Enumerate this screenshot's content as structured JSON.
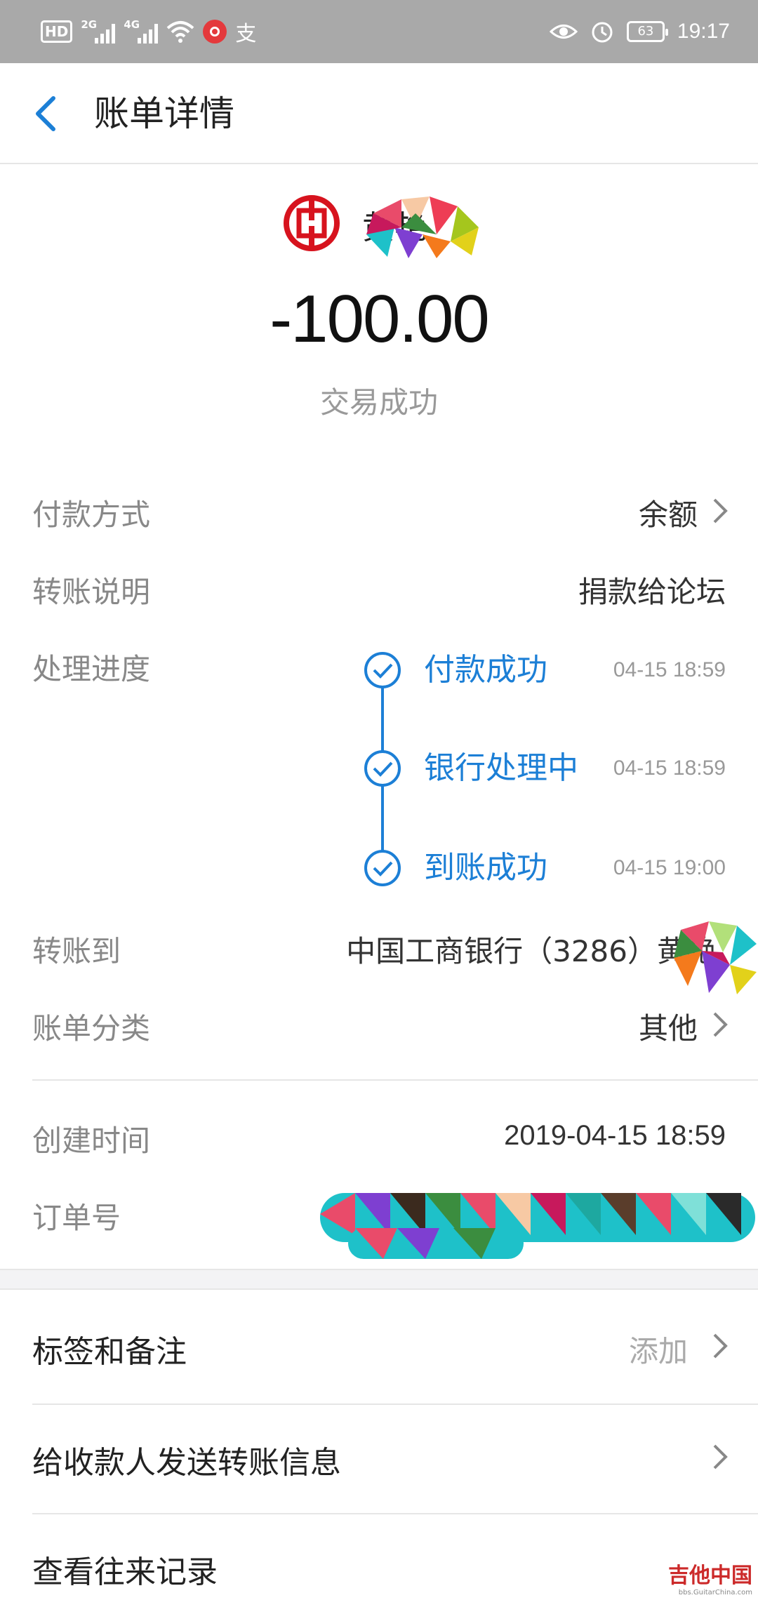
{
  "status_bar": {
    "hd_badge": "HD",
    "network_1": "2G",
    "network_2": "4G",
    "alipay_glyph": "支",
    "battery": "63",
    "time": "19:17",
    "icons": [
      "wifi-icon",
      "netease-music-icon",
      "eye-icon",
      "alarm-icon"
    ]
  },
  "header": {
    "title": "账单详情"
  },
  "summary": {
    "payee_name": "黄艳",
    "amount": "-100.00",
    "status": "交易成功"
  },
  "details": {
    "payment_method_label": "付款方式",
    "payment_method_value": "余额",
    "transfer_note_label": "转账说明",
    "transfer_note_value": "捐款给论坛",
    "progress_label": "处理进度",
    "progress_steps": [
      {
        "label": "付款成功",
        "time": "04-15 18:59"
      },
      {
        "label": "银行处理中",
        "time": "04-15 18:59"
      },
      {
        "label": "到账成功",
        "time": "04-15 19:00"
      }
    ],
    "transfer_to_label": "转账到",
    "transfer_to_value": "中国工商银行（3286）黄艳",
    "category_label": "账单分类",
    "category_value": "其他",
    "created_label": "创建时间",
    "created_value": "2019-04-15 18:59",
    "order_label": "订单号"
  },
  "actions": {
    "tags_label": "标签和备注",
    "tags_hint": "添加",
    "send_info_label": "给收款人发送转账信息",
    "history_label": "查看往来记录"
  },
  "watermark": {
    "text": "吉他中国",
    "sub": "bbs.GuitarChina.com"
  },
  "colors": {
    "accent": "#1c7fd6",
    "status_bar": "#a9a9a9",
    "bank_red": "#d7131e"
  }
}
